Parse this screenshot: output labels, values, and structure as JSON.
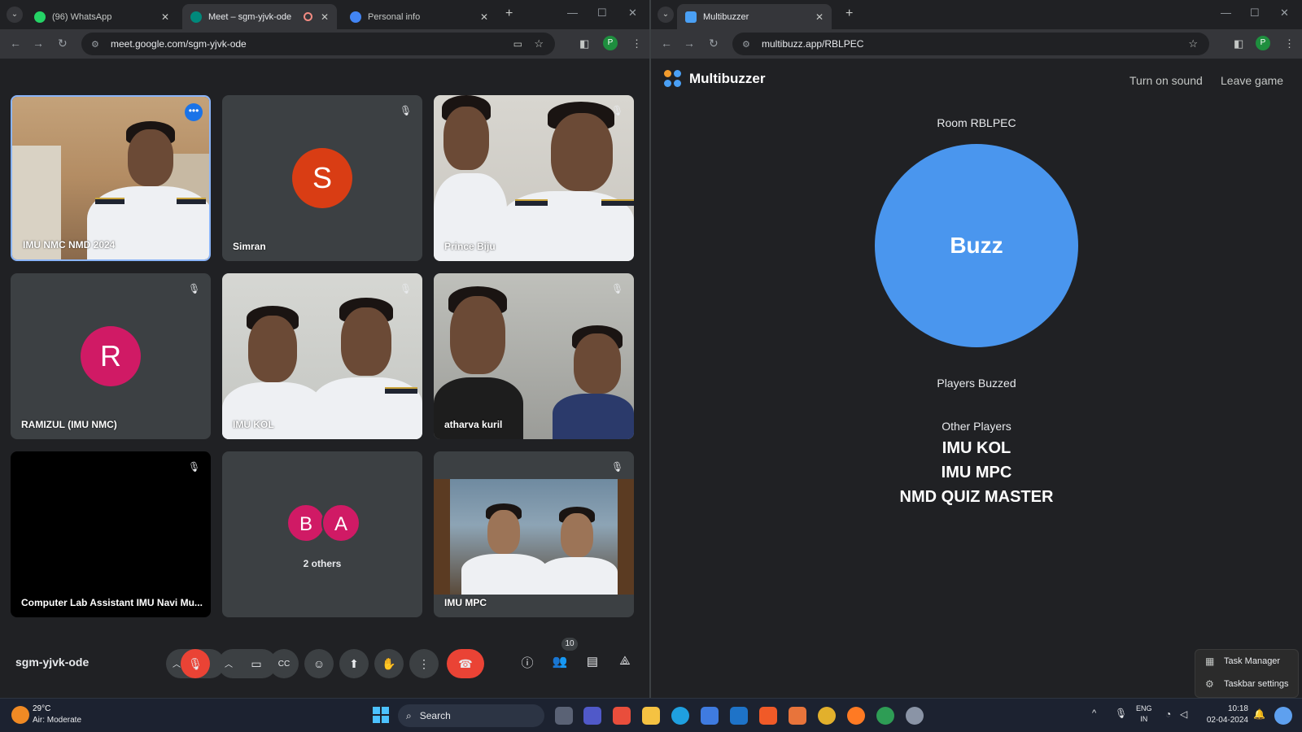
{
  "left_browser": {
    "tabs": [
      {
        "label": "(96) WhatsApp",
        "color": "#25d366"
      },
      {
        "label": "Meet – sgm-yjvk-ode",
        "color": "#00897b"
      },
      {
        "label": "Personal info",
        "color": "#4285f4"
      }
    ],
    "url": "meet.google.com/sgm-yjvk-ode",
    "profile_initial": "P"
  },
  "meet": {
    "meeting_code": "sgm-yjvk-ode",
    "participant_count": "10",
    "tiles": [
      {
        "name": "IMU NMC NMD 2024",
        "type": "video",
        "muted": false,
        "active": true
      },
      {
        "name": "Simran",
        "type": "avatar",
        "initial": "S",
        "color": "#d93d14",
        "muted": true
      },
      {
        "name": "Prince Biju",
        "type": "video",
        "muted": true
      },
      {
        "name": "RAMIZUL (IMU NMC)",
        "type": "avatar",
        "initial": "R",
        "color": "#d01a65",
        "muted": true
      },
      {
        "name": "IMU KOL",
        "type": "video",
        "muted": true
      },
      {
        "name": "atharva kuril",
        "type": "video",
        "muted": true
      },
      {
        "name": "Computer Lab Assistant IMU Navi Mu...",
        "type": "black",
        "muted": true
      },
      {
        "name": "2 others",
        "type": "group",
        "initials": [
          "B",
          "A"
        ],
        "color": "#d01a65"
      },
      {
        "name": "IMU MPC",
        "type": "video",
        "muted": true
      }
    ]
  },
  "right_browser": {
    "tab_label": "Multibuzzer",
    "url": "multibuzz.app/RBLPEC",
    "profile_initial": "P"
  },
  "multibuzzer": {
    "brand": "Multibuzzer",
    "turn_on_sound": "Turn on sound",
    "leave_game": "Leave game",
    "room": "Room RBLPEC",
    "buzz_label": "Buzz",
    "buzz_color": "#4a96ee",
    "players_buzzed_heading": "Players Buzzed",
    "other_players_heading": "Other Players",
    "other_players": [
      "IMU KOL",
      "IMU MPC",
      "NMD QUIZ MASTER"
    ]
  },
  "context_menu": {
    "items": [
      "Task Manager",
      "Taskbar settings"
    ]
  },
  "taskbar": {
    "weather_temp": "29°C",
    "weather_desc": "Air: Moderate",
    "search_label": "Search",
    "lang_top": "ENG",
    "lang_bottom": "IN",
    "time": "10:18",
    "date": "02-04-2024"
  }
}
